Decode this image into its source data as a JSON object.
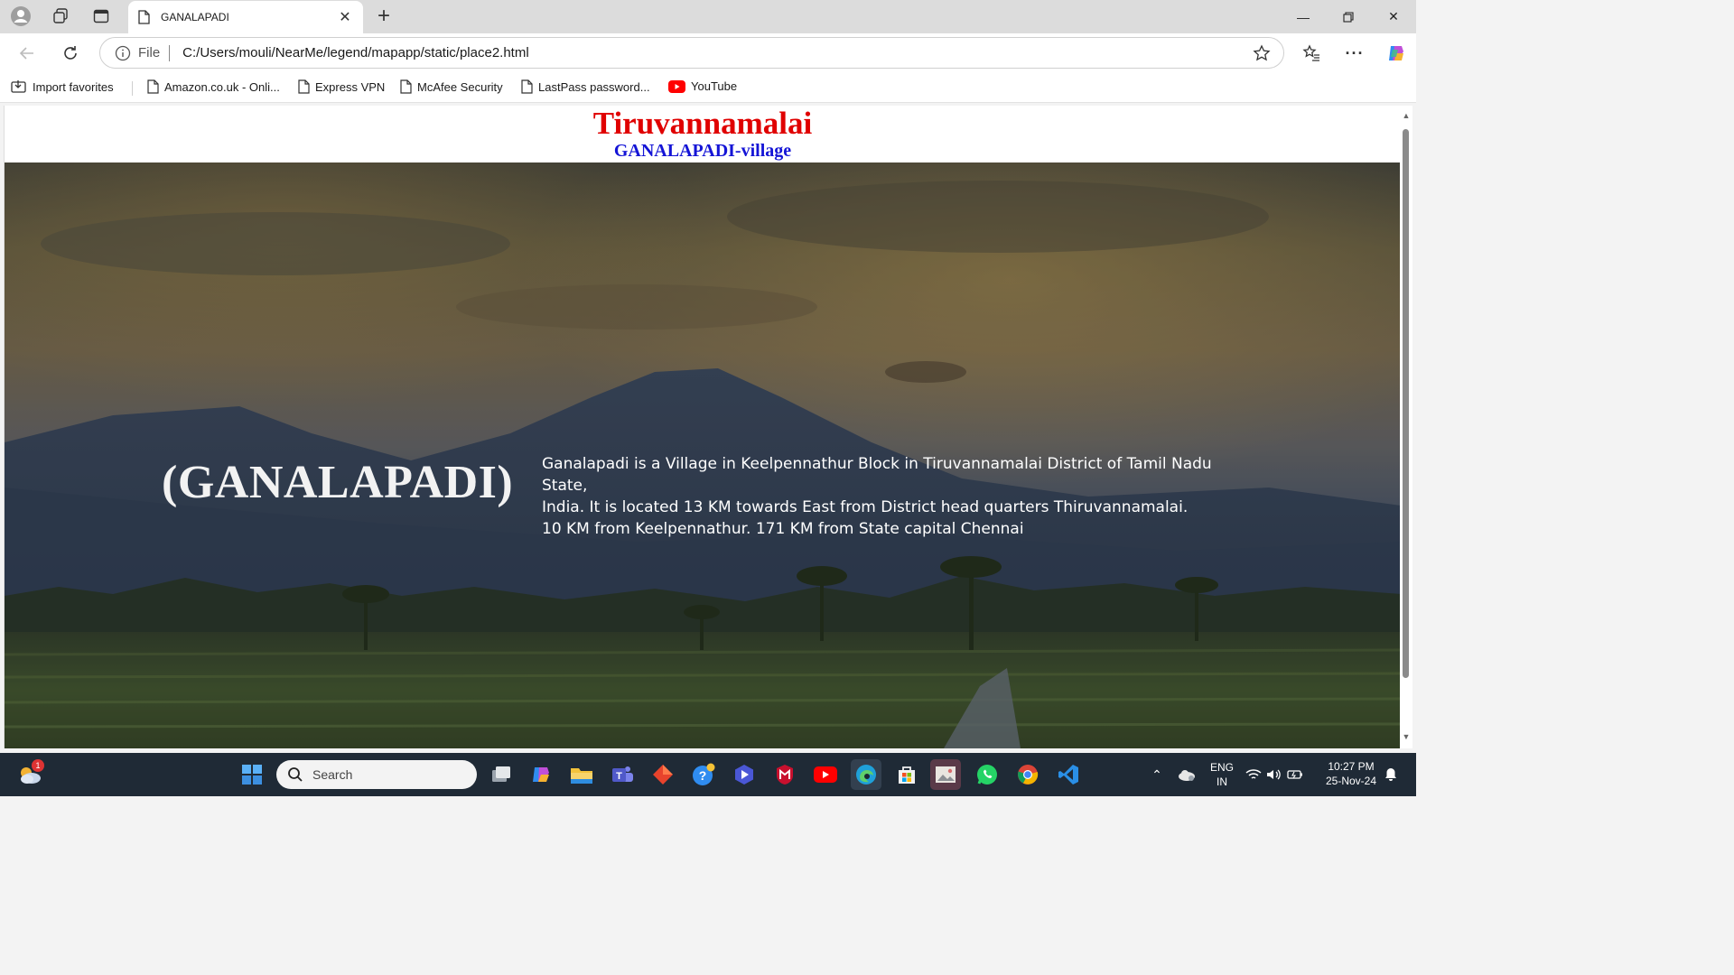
{
  "browser": {
    "tab_title": "GANALAPADI",
    "url_scheme_label": "File",
    "url": "C:/Users/mouli/NearMe/legend/mapapp/static/place2.html",
    "favorites": [
      {
        "label": "Import favorites",
        "icon": "import-icon"
      },
      {
        "label": "Amazon.co.uk - Onli...",
        "icon": "page-icon"
      },
      {
        "label": "Express VPN",
        "icon": "page-icon"
      },
      {
        "label": "McAfee Security",
        "icon": "page-icon"
      },
      {
        "label": "LastPass password...",
        "icon": "page-icon"
      },
      {
        "label": "YouTube",
        "icon": "youtube-icon"
      }
    ]
  },
  "page": {
    "title": "Tiruvannamalai",
    "subtitle": "GANALAPADI-village",
    "hero_heading": "(GANALAPADI)",
    "hero_description_lines": [
      "Ganalapadi is a Village in Keelpennathur Block in Tiruvannamalai District of Tamil Nadu State,",
      "India. It is located 13 KM towards East from District head quarters Thiruvannamalai.",
      "10 KM from Keelpennathur. 171 KM from State capital Chennai"
    ],
    "colors": {
      "title": "#e00000",
      "subtitle": "#1414d6"
    }
  },
  "taskbar": {
    "search_placeholder": "Search",
    "weather_badge": "1",
    "language": "ENG",
    "region": "IN",
    "time": "10:27 PM",
    "date": "25-Nov-24"
  }
}
